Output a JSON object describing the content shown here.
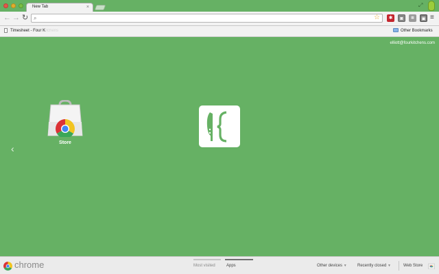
{
  "browser": {
    "active_tab_title": "New Tab",
    "tab_close_glyph": "×",
    "url_value": "",
    "extension_labels": [
      "",
      "",
      "",
      ""
    ]
  },
  "bookmarks": {
    "item_label": "Timesheet - Four K",
    "item_fade": "itchens",
    "other_label": "Other Bookmarks"
  },
  "ntp": {
    "user_email": "elliott@fourkitchens.com",
    "apps": [
      {
        "label": "Store",
        "icon": "chrome-web-store-icon"
      },
      {
        "label": "",
        "icon": "four-kitchens-app-icon"
      }
    ]
  },
  "footer": {
    "brand": "chrome",
    "tabs": [
      {
        "label": "Most visited",
        "active": false
      },
      {
        "label": "Apps",
        "active": true
      }
    ],
    "other_devices": "Other devices",
    "recently_closed": "Recently closed",
    "web_store": "Web Store"
  },
  "colors": {
    "theme_green": "#66b164",
    "toolbar": "#f2f2f2"
  }
}
